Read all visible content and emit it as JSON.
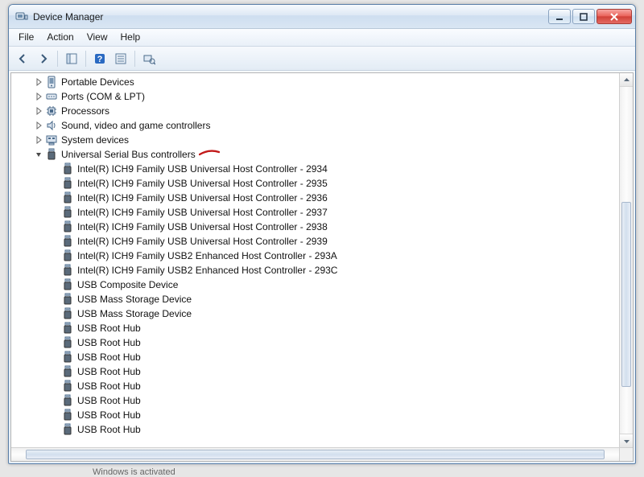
{
  "window": {
    "title": "Device Manager"
  },
  "menu": {
    "file": "File",
    "action": "Action",
    "view": "View",
    "help": "Help"
  },
  "tree": {
    "categories": [
      {
        "label": "Portable Devices",
        "icon": "portable-devices-icon",
        "expanded": false
      },
      {
        "label": "Ports (COM & LPT)",
        "icon": "ports-icon",
        "expanded": false
      },
      {
        "label": "Processors",
        "icon": "processor-icon",
        "expanded": false
      },
      {
        "label": "Sound, video and game controllers",
        "icon": "sound-icon",
        "expanded": false
      },
      {
        "label": "System devices",
        "icon": "system-devices-icon",
        "expanded": false
      },
      {
        "label": "Universal Serial Bus controllers",
        "icon": "usb-category-icon",
        "expanded": true
      }
    ],
    "usb_children": [
      "Intel(R) ICH9 Family USB Universal Host Controller - 2934",
      "Intel(R) ICH9 Family USB Universal Host Controller - 2935",
      "Intel(R) ICH9 Family USB Universal Host Controller - 2936",
      "Intel(R) ICH9 Family USB Universal Host Controller - 2937",
      "Intel(R) ICH9 Family USB Universal Host Controller - 2938",
      "Intel(R) ICH9 Family USB Universal Host Controller - 2939",
      "Intel(R) ICH9 Family USB2 Enhanced Host Controller - 293A",
      "Intel(R) ICH9 Family USB2 Enhanced Host Controller - 293C",
      "USB Composite Device",
      "USB Mass Storage Device",
      "USB Mass Storage Device",
      "USB Root Hub",
      "USB Root Hub",
      "USB Root Hub",
      "USB Root Hub",
      "USB Root Hub",
      "USB Root Hub",
      "USB Root Hub",
      "USB Root Hub"
    ]
  },
  "status": {
    "text": "Windows is activated"
  },
  "colors": {
    "annotation_red": "#c21a1a"
  }
}
